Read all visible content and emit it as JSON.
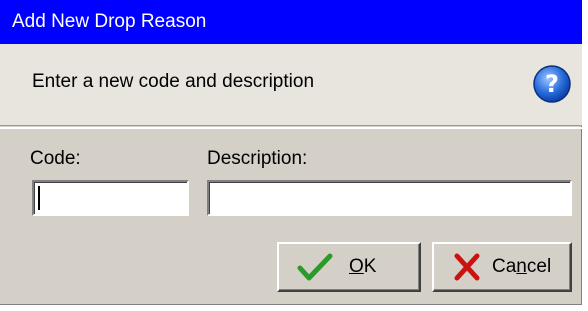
{
  "window": {
    "title": "Add New Drop Reason"
  },
  "header": {
    "text": "Enter a new code and description",
    "help_icon": "help-icon"
  },
  "form": {
    "code_label": "Code:",
    "code_value": "",
    "description_label": "Description:",
    "description_value": ""
  },
  "buttons": {
    "ok": {
      "label_pre": "",
      "label_underlined": "O",
      "label_post": "K",
      "icon": "checkmark-icon"
    },
    "cancel": {
      "label_pre": "Ca",
      "label_underlined": "n",
      "label_post": "cel",
      "icon": "x-icon"
    }
  },
  "colors": {
    "titlebar": "#0000ff",
    "dialog_bg": "#d4d0c8",
    "header_bg": "#e7e5de",
    "ok_check": "#2a9a2a",
    "cancel_x": "#cc1111"
  }
}
